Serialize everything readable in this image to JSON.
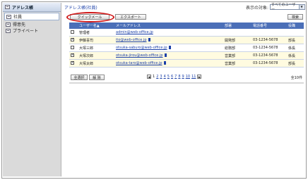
{
  "sidebar": {
    "header": "アドレス帳",
    "items": [
      {
        "label": "社員",
        "icon": "book-icon",
        "active": true
      },
      {
        "label": "得意先",
        "icon": "book-icon",
        "active": false
      },
      {
        "label": "プライベート",
        "icon": "book-icon",
        "active": false
      }
    ]
  },
  "header": {
    "breadcrumb": "アドレス帳(社員)",
    "target_label": "表示の対象:",
    "target_value": "すべてのユーザー"
  },
  "toolbar": {
    "quick_mail": "クイックメール",
    "export": "エクスポート",
    "search": "検索"
  },
  "table": {
    "columns": [
      "ユーザー名▲",
      "メールアドレス",
      "部署",
      "電話番号",
      "役職"
    ],
    "rows": [
      {
        "checked": false,
        "name": "管理者",
        "email": "admin@web-office.jp",
        "dept": "",
        "phone": "",
        "title": "",
        "mark": false
      },
      {
        "checked": true,
        "name": "伊藤喜司",
        "email": "ito@web-office.jp",
        "dept": "開発部",
        "phone": "03-1234-5678",
        "title": "部長",
        "mark": true
      },
      {
        "checked": false,
        "name": "大塚三郎",
        "email": "otsuka-saburo@web-office.jp",
        "dept": "総務部",
        "phone": "03-1234-5678",
        "title": "係長",
        "mark": true
      },
      {
        "checked": true,
        "name": "大塚次郎",
        "email": "otsuka-jirou@web-office.jp",
        "dept": "営業部",
        "phone": "03-1234-5678",
        "title": "係長",
        "mark": true
      },
      {
        "checked": true,
        "name": "大塚太郎",
        "email": "otsuka-taro@web-office.jp",
        "dept": "営業部",
        "phone": "03-1234-5678",
        "title": "部長",
        "mark": true
      }
    ]
  },
  "footer": {
    "select_all": "全選択",
    "deselect": "解 除",
    "pages": [
      "1",
      "2",
      "3",
      "4",
      "5",
      "6",
      "7",
      "8",
      "9",
      "10",
      "11"
    ],
    "current_page": "1",
    "count": "全10件"
  }
}
